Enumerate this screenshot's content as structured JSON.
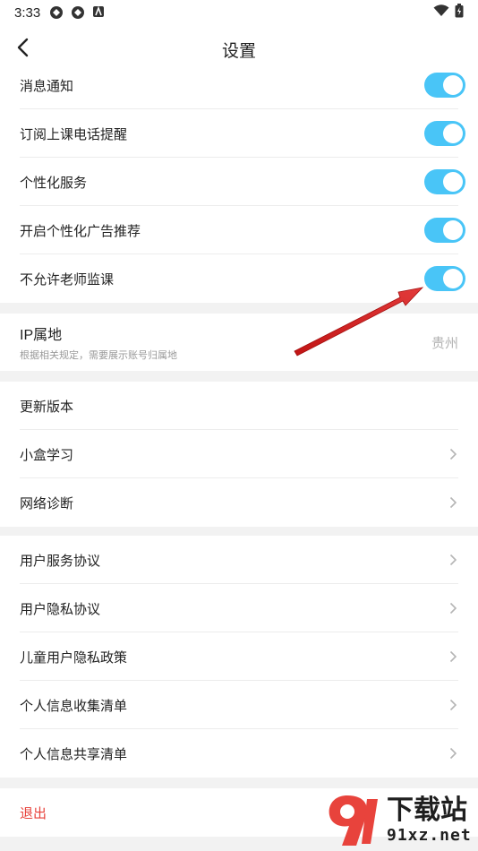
{
  "status_bar": {
    "time": "3:33",
    "icons": [
      "app-icon-1",
      "app-icon-2",
      "app-icon-3"
    ],
    "right_icons": [
      "wifi-icon",
      "battery-icon"
    ]
  },
  "header": {
    "title": "设置",
    "back_icon": "chevron-left-icon"
  },
  "toggles": [
    {
      "label": "消息通知",
      "on": true
    },
    {
      "label": "订阅上课电话提醒",
      "on": true
    },
    {
      "label": "个性化服务",
      "on": true
    },
    {
      "label": "开启个性化广告推荐",
      "on": true
    },
    {
      "label": "不允许老师监课",
      "on": true
    }
  ],
  "ip": {
    "title": "IP属地",
    "subtitle": "根据相关规定，需要展示账号归属地",
    "value": "贵州"
  },
  "app_group": [
    {
      "label": "更新版本",
      "chevron": false
    },
    {
      "label": "小盒学习",
      "chevron": true
    },
    {
      "label": "网络诊断",
      "chevron": true
    }
  ],
  "policy_group": [
    {
      "label": "用户服务协议"
    },
    {
      "label": "用户隐私协议"
    },
    {
      "label": "儿童用户隐私政策"
    },
    {
      "label": "个人信息收集清单"
    },
    {
      "label": "个人信息共享清单"
    }
  ],
  "logout": {
    "label": "退出"
  },
  "watermark": {
    "main": "下载站",
    "domain": "91xz.net"
  },
  "colors": {
    "toggle_on": "#49c5f7",
    "logout": "#e8433c",
    "arrow": "#d62323"
  }
}
